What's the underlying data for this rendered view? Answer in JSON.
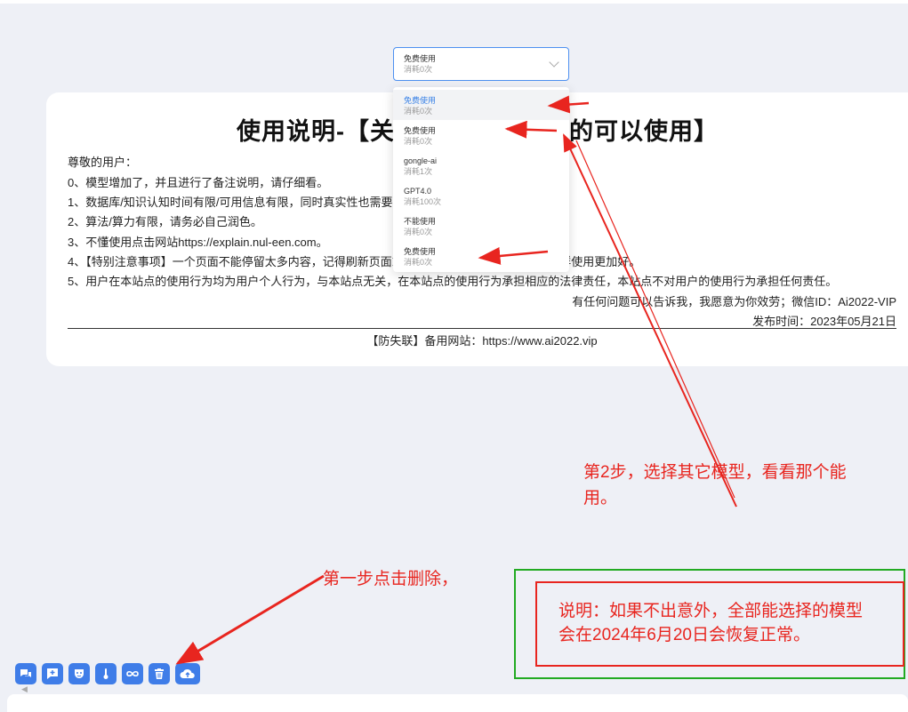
{
  "model_select": {
    "selected": {
      "name": "免费使用",
      "cost": "消耗0次"
    }
  },
  "dropdown": {
    "options": [
      {
        "name": "免费使用",
        "cost": "消耗0次",
        "active": true
      },
      {
        "name": "免费使用",
        "cost": "消耗0次"
      },
      {
        "name": "gongle-ai",
        "cost": "消耗1次"
      },
      {
        "name": "GPT4.0",
        "cost": "消耗100次"
      },
      {
        "name": "不能使用",
        "cost": "消耗0次"
      },
      {
        "name": "免费使用",
        "cost": "消耗0次"
      }
    ]
  },
  "notice": {
    "title": "使用说明-【关闭注册，已注册的可以使用】",
    "lines": [
      "尊敬的用户：",
      "0、模型增加了，并且进行了备注说明，请仔细看。",
      "1、数据库/知识认知时间有限/可用信息有限，同时真实性也需要自己判断。",
      "2、算法/算力有限，请务必自己润色。",
      "3、不懂使用点击网站https://explain.nul-een.com。",
      "4、【特别注意事项】一个页面不能停留太多内容，记得刷新页面或者点击删除（垃圾桶按钮），这样使用更加好。",
      "5、用户在本站点的使用行为均为用户个人行为，与本站点无关，在本站点的使用行为承担相应的法律责任，本站点不对用户的使用行为承担任何责任。"
    ],
    "contact": "有任何问题可以告诉我，我愿意为你效劳；微信ID：Ai2022-VIP",
    "publish_time": "发布时间：2023年05月21日",
    "mirror_site": "【防失联】备用网站：https://www.ai2022.vip"
  },
  "annotations": {
    "step2": [
      "第2步，选择其它模型，看看那个能",
      "用。"
    ],
    "step1": "第一步点击删除，",
    "note": [
      "说明：如果不出意外，全部能选择的模型",
      "会在2024年6月20日会恢复正常。"
    ]
  },
  "toolbar": {
    "buttons": [
      "chat-icon",
      "new-chat-icon",
      "mask-icon",
      "thermometer-icon",
      "infinity-icon",
      "trash-icon",
      "cloud-upload-icon"
    ]
  },
  "colors": {
    "accent": "#3f7de8",
    "annotation_red": "#e8251f",
    "annotation_green": "#22aa22",
    "page_bg": "#eef0f6"
  }
}
